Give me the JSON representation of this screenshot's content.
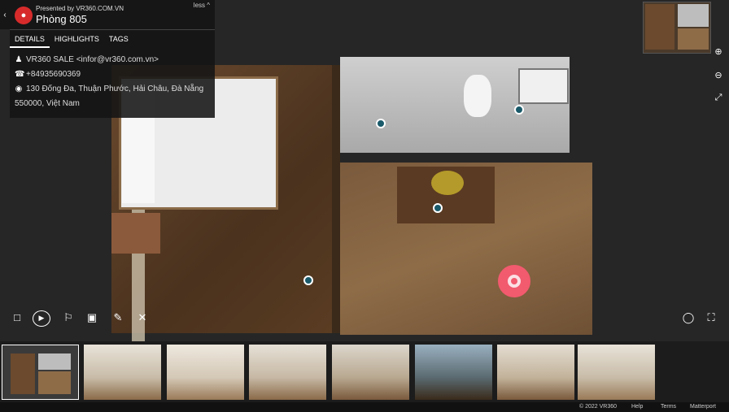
{
  "header": {
    "presented_by": "Presented by VR360.COM.VN",
    "title": "Phòng 805",
    "less_label": "less ^",
    "collapse_icon": "chevron-left-icon"
  },
  "tabs": [
    {
      "label": "DETAILS",
      "active": true
    },
    {
      "label": "HIGHLIGHTS",
      "active": false
    },
    {
      "label": "TAGS",
      "active": false
    }
  ],
  "details": {
    "contact": "VR360 SALE <infor@vr360.com.vn>",
    "phone": "+84935690369",
    "address_line1": "130 Đống Đa, Thuận Phước, Hải Châu, Đà Nẵng",
    "address_line2": "550000, Việt Nam"
  },
  "controls": {
    "zoom_in_icon": "zoom-in-icon",
    "zoom_out_icon": "zoom-out-icon",
    "fullscreen_icon": "expand-icon",
    "bottom_left_icons": [
      "dollhouse-icon",
      "play-icon",
      "walk-icon",
      "floorplan-icon",
      "measure-icon",
      "mute-icon"
    ],
    "bottom_right_icons": [
      "vr-icon",
      "fullscreen-icon"
    ]
  },
  "thumbnails": [
    {
      "name": "floorplan",
      "selected": true
    },
    {
      "name": "bedroom-view-1",
      "selected": false
    },
    {
      "name": "bedroom-view-2",
      "selected": false
    },
    {
      "name": "bedroom-view-3",
      "selected": false
    },
    {
      "name": "bedroom-view-4",
      "selected": false
    },
    {
      "name": "living-view-1",
      "selected": false
    },
    {
      "name": "window-view",
      "selected": false
    },
    {
      "name": "living-view-2",
      "selected": false
    },
    {
      "name": "kitchen-view",
      "selected": false
    }
  ],
  "footer": {
    "copyright": "© 2022 VR360",
    "help": "Help",
    "terms": "Terms",
    "brand": "Matterport"
  },
  "colors": {
    "background": "#262626",
    "target": "#f25a6e",
    "logo": "#d72b2b"
  }
}
